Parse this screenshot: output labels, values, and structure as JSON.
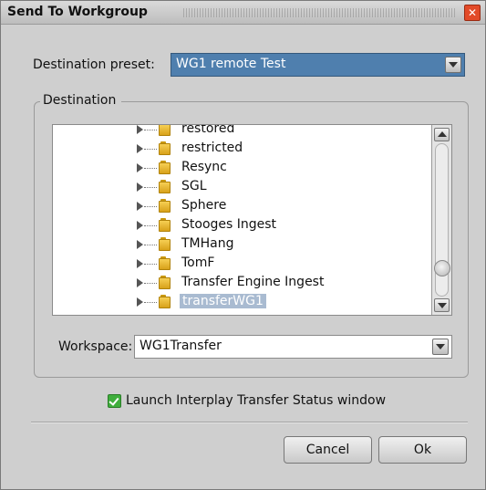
{
  "window": {
    "title": "Send To Workgroup"
  },
  "destination_preset": {
    "label": "Destination preset:",
    "value": "WG1 remote Test"
  },
  "destination": {
    "group_label": "Destination",
    "tree_items": [
      {
        "label": "restored",
        "selected": false
      },
      {
        "label": "restricted",
        "selected": false
      },
      {
        "label": "Resync",
        "selected": false
      },
      {
        "label": "SGL",
        "selected": false
      },
      {
        "label": "Sphere",
        "selected": false
      },
      {
        "label": "Stooges Ingest",
        "selected": false
      },
      {
        "label": "TMHang",
        "selected": false
      },
      {
        "label": "TomF",
        "selected": false
      },
      {
        "label": "Transfer Engine Ingest",
        "selected": false
      },
      {
        "label": "transferWG1",
        "selected": true
      }
    ],
    "scroll_position": 0.85
  },
  "workspace": {
    "label": "Workspace:",
    "value": "WG1Transfer"
  },
  "launch_status": {
    "label": "Launch Interplay Transfer Status window",
    "checked": true
  },
  "buttons": {
    "cancel": "Cancel",
    "ok": "Ok"
  },
  "colors": {
    "selection_bg": "#a9bbd1",
    "preset_bg": "#4f7fae",
    "checkbox": "#3fae3c",
    "close_button": "#e24a28"
  }
}
